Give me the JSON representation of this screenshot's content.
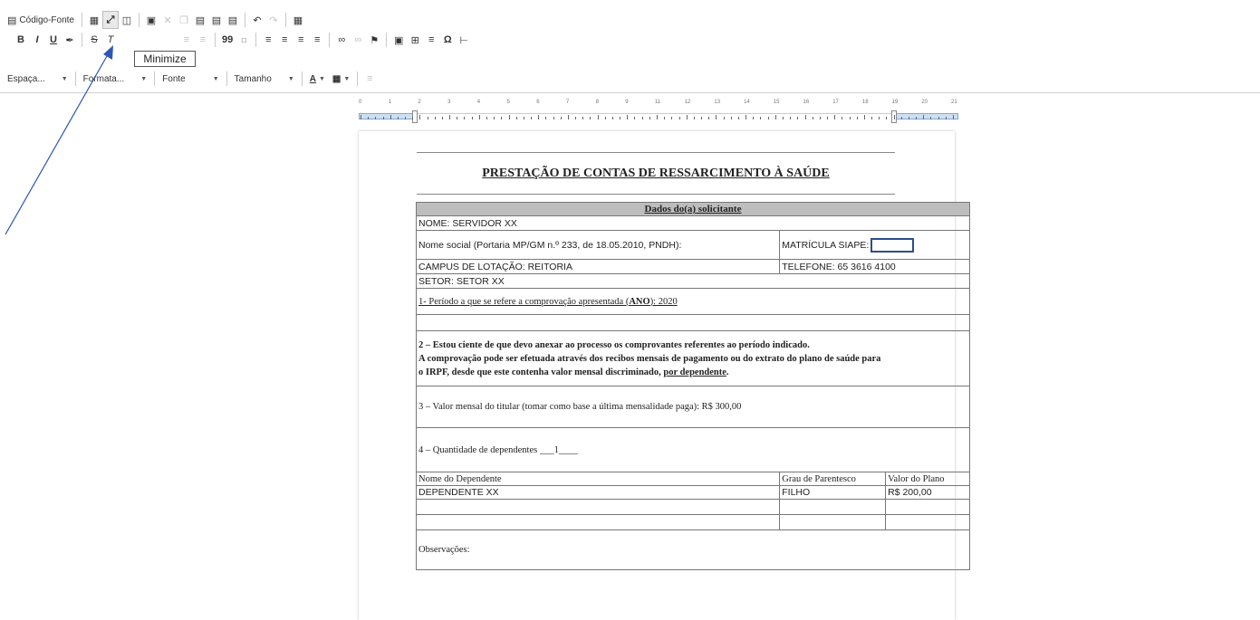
{
  "toolbar": {
    "row1": {
      "source_label": "Código-Fonte"
    },
    "row2": {
      "bold": "B",
      "italic": "I",
      "underline": "U",
      "blockquote": "99",
      "omega": "Ω"
    },
    "row3": {
      "spacing_label": "Espaça...",
      "format_label": "Formata...",
      "font_label": "Fonte",
      "size_label": "Tamanho",
      "text_color_label": "A"
    },
    "tooltip": "Minimize"
  },
  "ruler": {
    "numbers": [
      "0",
      "1",
      "2",
      "3",
      "4",
      "5",
      "6",
      "7",
      "8",
      "9",
      "11",
      "12",
      "13",
      "14",
      "15",
      "16",
      "17",
      "18",
      "19",
      "20",
      "21"
    ]
  },
  "document": {
    "title": "PRESTAÇÃO DE CONTAS DE RESSARCIMENTO À SAÚDE",
    "section_header": "Dados do(a) solicitante",
    "name": "NOME: SERVIDOR XX",
    "social_name": "Nome social (Portaria MP/GM n.º 233, de 18.05.2010, PNDH):",
    "matricula": "MATRÍCULA SIAPE:",
    "campus": "CAMPUS DE LOTAÇÃO: REITORIA",
    "telefone": "TELEFONE: 65 3616 4100",
    "setor": "SETOR: SETOR XX",
    "item1_prefix": "1- Período a que se refere a comprovação apresentada (",
    "item1_ano": "ANO",
    "item1_suffix": "): 2020",
    "item2_line1": "2 – Estou ciente de que devo anexar ao processo os comprovantes referentes ao período indicado.",
    "item2_line2": "A comprovação pode ser efetuada através dos recibos mensais de pagamento ou do extrato do plano de saúde para",
    "item2_line3_prefix": "o IRPF, desde que este contenha valor mensal discriminado, ",
    "item2_line3_link": "por dependente",
    "item2_line3_suffix": ".",
    "item3": "3 – Valor mensal do titular (tomar como base a última mensalidade paga): R$ 300,00",
    "item4_prefix": "4 – Quantidade de dependentes ",
    "item4_value": "___1____",
    "dep_headers": [
      "Nome do Dependente",
      "Grau de Parentesco",
      "Valor do Plano"
    ],
    "dep_rows": [
      [
        "DEPENDENTE XX",
        "FILHO",
        "R$ 200,00"
      ],
      [
        "",
        "",
        ""
      ],
      [
        "",
        "",
        ""
      ]
    ],
    "observacoes": "Observações:"
  },
  "colors": {
    "header_gray": "#bdbdbd",
    "siape_box_border": "#2d4e8c",
    "annotation_arrow": "#2d56b5"
  }
}
